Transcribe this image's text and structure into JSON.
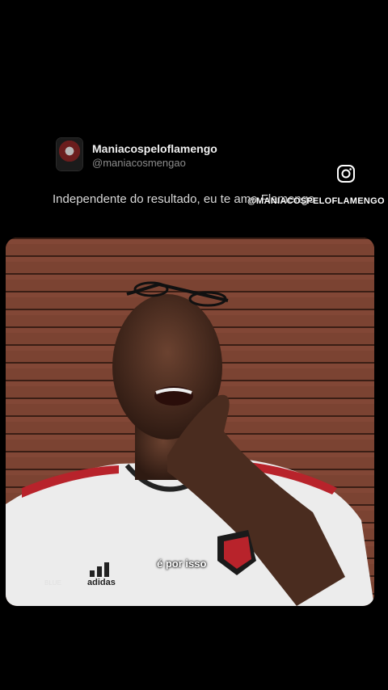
{
  "post": {
    "author_name": "Maniacospeloflamengo",
    "author_handle": "@maniacosmengao",
    "text": "Independente do resultado, eu te amo Flamengo",
    "avatar_icon": "flamengo-crest-avatar"
  },
  "overlay": {
    "watermark": "@MANIACOSPELOFLAMENGO",
    "instagram_icon": "instagram-icon"
  },
  "video": {
    "caption": "é por isso",
    "corner_mark": "BLUE",
    "jersey_brand": "adidas"
  },
  "colors": {
    "background": "#000000",
    "wood": "#7a4230",
    "jersey": "#f2f2f2",
    "accent_red": "#c4202a"
  }
}
